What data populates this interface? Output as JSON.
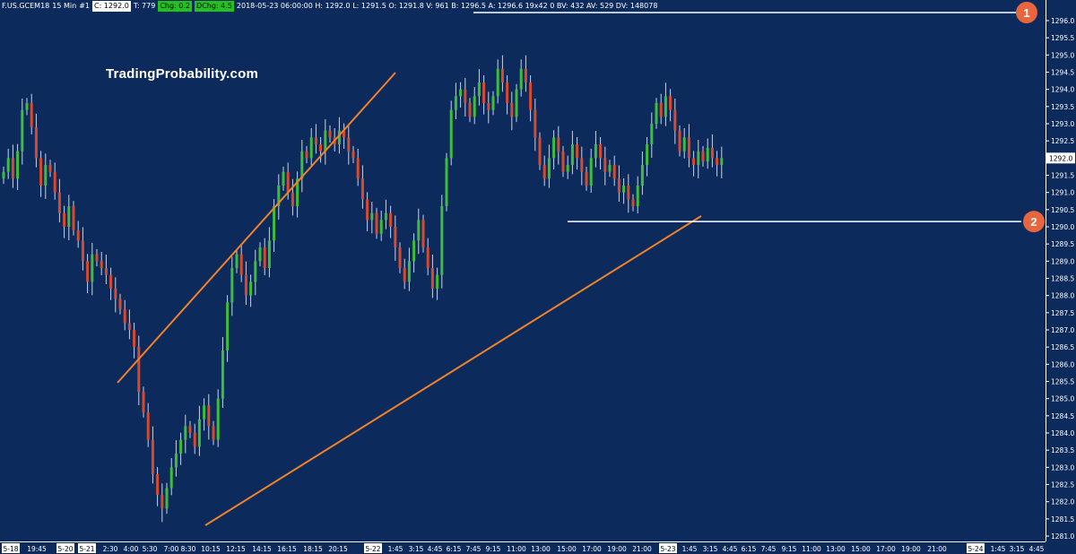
{
  "header": {
    "symbol": "F.US.GCEM18",
    "interval": "15 Min",
    "bar_index": "#1",
    "close": "C: 1292.0",
    "ticks": "T: 779",
    "chg_label": "Chg: 0.2",
    "dchg_label": "DChg: 4.5",
    "details": "2018-05-23 06:00:00 H: 1292.0 L: 1291.5 O: 1291.8 V: 961 B: 1296.5 A: 1296.6 19x42 0 BV: 432 AV: 529 DV: 148078"
  },
  "watermark": "TradingProbability.com",
  "colors": {
    "background": "#0d2a5c",
    "up": "#3dbd3d",
    "down": "#d64a2f",
    "trend": "#f0832a",
    "level": "#ffffff",
    "marker": "#e8663d"
  },
  "chart_data": {
    "type": "candlestick",
    "ylim": [
      1281.0,
      1296.25
    ],
    "y_ticks": [
      "1281.0",
      "1281.5",
      "1282.0",
      "1282.5",
      "1283.0",
      "1283.5",
      "1284.0",
      "1284.5",
      "1285.0",
      "1285.5",
      "1286.0",
      "1286.5",
      "1287.0",
      "1287.5",
      "1288.0",
      "1288.5",
      "1289.0",
      "1289.5",
      "1290.0",
      "1290.5",
      "1291.0",
      "1291.5",
      "1292.0",
      "1292.5",
      "1293.0",
      "1293.5",
      "1294.0",
      "1294.5",
      "1295.0",
      "1295.5",
      "1296.0"
    ],
    "last_price": "1292.0",
    "x_ticks": [
      {
        "label": "5-18",
        "boxed": true
      },
      {
        "label": "19:45",
        "boxed": false
      },
      {
        "label": "5-20",
        "boxed": true
      },
      {
        "label": "5-21",
        "boxed": true
      },
      {
        "label": "2:30",
        "boxed": false
      },
      {
        "label": "4:00",
        "boxed": false
      },
      {
        "label": "5:30",
        "boxed": false
      },
      {
        "label": "7:00",
        "boxed": false
      },
      {
        "label": "8:30",
        "boxed": false
      },
      {
        "label": "10:15",
        "boxed": false
      },
      {
        "label": "12:15",
        "boxed": false
      },
      {
        "label": "14:15",
        "boxed": false
      },
      {
        "label": "16:15",
        "boxed": false
      },
      {
        "label": "18:15",
        "boxed": false
      },
      {
        "label": "20:15",
        "boxed": false
      },
      {
        "label": "5-22",
        "boxed": true
      },
      {
        "label": "1:45",
        "boxed": false
      },
      {
        "label": "3:15",
        "boxed": false
      },
      {
        "label": "4:45",
        "boxed": false
      },
      {
        "label": "6:15",
        "boxed": false
      },
      {
        "label": "7:45",
        "boxed": false
      },
      {
        "label": "9:15",
        "boxed": false
      },
      {
        "label": "11:00",
        "boxed": false
      },
      {
        "label": "13:00",
        "boxed": false
      },
      {
        "label": "15:00",
        "boxed": false
      },
      {
        "label": "17:00",
        "boxed": false
      },
      {
        "label": "19:00",
        "boxed": false
      },
      {
        "label": "21:00",
        "boxed": false
      },
      {
        "label": "5-23",
        "boxed": true
      },
      {
        "label": "1:45",
        "boxed": false
      },
      {
        "label": "3:15",
        "boxed": false
      },
      {
        "label": "4:45",
        "boxed": false
      },
      {
        "label": "6:15",
        "boxed": false
      },
      {
        "label": "7:45",
        "boxed": false
      },
      {
        "label": "9:15",
        "boxed": false
      },
      {
        "label": "11:00",
        "boxed": false
      },
      {
        "label": "13:00",
        "boxed": false
      },
      {
        "label": "15:00",
        "boxed": false
      },
      {
        "label": "17:00",
        "boxed": false
      },
      {
        "label": "19:00",
        "boxed": false
      },
      {
        "label": "21:00",
        "boxed": false
      },
      {
        "label": "5-24",
        "boxed": true
      },
      {
        "label": "1:45",
        "boxed": false
      },
      {
        "label": "3:15",
        "boxed": false
      },
      {
        "label": "4:45",
        "boxed": false
      }
    ],
    "candles_close_path": [
      1291.6,
      1292.0,
      1291.4,
      1292.2,
      1293.4,
      1293.6,
      1292.9,
      1292.0,
      1291.2,
      1291.8,
      1291.6,
      1291.0,
      1290.4,
      1290.0,
      1290.6,
      1289.9,
      1289.6,
      1289.0,
      1288.4,
      1289.2,
      1289.0,
      1288.8,
      1288.6,
      1288.2,
      1287.9,
      1287.6,
      1287.2,
      1287.0,
      1286.5,
      1285.2,
      1284.6,
      1283.8,
      1282.8,
      1282.2,
      1281.8,
      1282.4,
      1283.0,
      1283.4,
      1283.8,
      1284.2,
      1284.0,
      1283.6,
      1284.4,
      1284.8,
      1284.2,
      1283.8,
      1285.0,
      1286.4,
      1287.8,
      1288.8,
      1289.2,
      1288.6,
      1288.0,
      1288.4,
      1289.0,
      1289.4,
      1288.8,
      1289.6,
      1290.6,
      1291.2,
      1291.6,
      1291.0,
      1290.6,
      1291.4,
      1292.2,
      1292.0,
      1292.6,
      1292.4,
      1292.2,
      1292.8,
      1292.6,
      1292.4,
      1292.8,
      1292.6,
      1292.2,
      1292.0,
      1291.4,
      1290.8,
      1290.2,
      1290.4,
      1289.8,
      1290.2,
      1290.4,
      1290.0,
      1289.4,
      1288.8,
      1288.4,
      1289.0,
      1289.6,
      1290.2,
      1289.4,
      1288.8,
      1288.2,
      1288.6,
      1290.6,
      1292.0,
      1293.4,
      1293.8,
      1294.0,
      1293.6,
      1293.2,
      1293.8,
      1294.2,
      1293.6,
      1293.4,
      1293.8,
      1294.6,
      1294.2,
      1293.6,
      1293.2,
      1294.0,
      1294.6,
      1294.2,
      1293.4,
      1292.6,
      1291.8,
      1291.4,
      1292.0,
      1292.6,
      1292.2,
      1291.6,
      1291.8,
      1292.4,
      1292.0,
      1291.6,
      1291.2,
      1292.0,
      1292.4,
      1292.0,
      1291.6,
      1291.8,
      1291.4,
      1291.0,
      1291.2,
      1290.8,
      1290.6,
      1291.2,
      1291.8,
      1292.4,
      1293.0,
      1293.6,
      1293.2,
      1293.8,
      1293.4,
      1292.8,
      1292.2,
      1292.6,
      1292.0,
      1291.8,
      1292.2,
      1291.9,
      1292.3,
      1292.0,
      1291.8,
      1292.0
    ]
  },
  "annotations": {
    "marker_1": "1",
    "marker_2": "2",
    "resistance_level": 1296.0,
    "support_level": 1290.1
  }
}
